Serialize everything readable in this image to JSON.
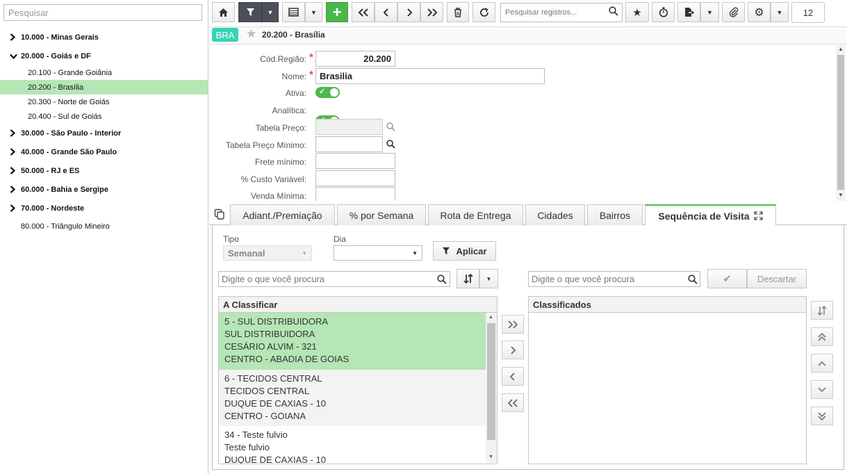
{
  "sidebar": {
    "search_placeholder": "Pesquisar",
    "items": [
      {
        "label": "10.000 - Minas Gerais"
      },
      {
        "label": "20.000 - Goiás e DF"
      },
      {
        "label": "20.100 - Grande Goiânia"
      },
      {
        "label": "20.200 - Brasília"
      },
      {
        "label": "20.300 - Norte de Goiás"
      },
      {
        "label": "20.400 - Sul de Goiás"
      },
      {
        "label": "30.000 - São Paulo - Interior"
      },
      {
        "label": "40.000 - Grande São Paulo"
      },
      {
        "label": "50.000 - RJ e ES"
      },
      {
        "label": "60.000 - Bahia e Sergipe"
      },
      {
        "label": "70.000 - Nordeste"
      },
      {
        "label": "80.000 - Triângulo Mineiro"
      }
    ]
  },
  "toolbar": {
    "search_placeholder": "Pesquisar registros...",
    "count": "12"
  },
  "header": {
    "tag": "BRA",
    "title": "20.200 - Brasília"
  },
  "form": {
    "cod_label": "Cód.Região:",
    "cod_value": "20.200",
    "nome_label": "Nome:",
    "nome_value": "Brasilia",
    "ativa_label": "Ativa:",
    "analitica_label": "Analítica:",
    "tabela_preco_label": "Tabela Preço:",
    "tabela_min_label": "Tabela Preço Mínimo:",
    "frete_label": "Frete mínimo:",
    "custo_label": "% Custo Variável:",
    "venda_label": "Venda Mínima:"
  },
  "tabs": [
    {
      "label": "Adiant./Premiação"
    },
    {
      "label": "% por Semana"
    },
    {
      "label": "Rota de Entrega"
    },
    {
      "label": "Cidades"
    },
    {
      "label": "Bairros"
    },
    {
      "label": "Sequência de Visita"
    }
  ],
  "filters": {
    "tipo_label": "Tipo",
    "tipo_value": "Semanal",
    "dia_label": "Dia",
    "dia_value": "",
    "apply_label": "Aplicar",
    "left_search_placeholder": "Digite o que você procura",
    "right_search_placeholder": "Digite o que você procura",
    "discard_label": "Descartar"
  },
  "lists": {
    "left_header": "A Classificar",
    "right_header": "Classificados",
    "left_items": [
      {
        "l1": "5 - SUL DISTRIBUIDORA",
        "l2": "SUL DISTRIBUIDORA",
        "l3": "CESÁRIO ALVIM - 321",
        "l4": "CENTRO - ABADIA DE GOIAS"
      },
      {
        "l1": "6 - TECIDOS CENTRAL",
        "l2": "TECIDOS CENTRAL",
        "l3": "DUQUE DE CAXIAS - 10",
        "l4": "CENTRO - GOIANA"
      },
      {
        "l1": "34 - Teste fulvio",
        "l2": "Teste fulvio",
        "l3": "DUQUE DE CAXIAS - 10",
        "l4": ""
      }
    ]
  }
}
